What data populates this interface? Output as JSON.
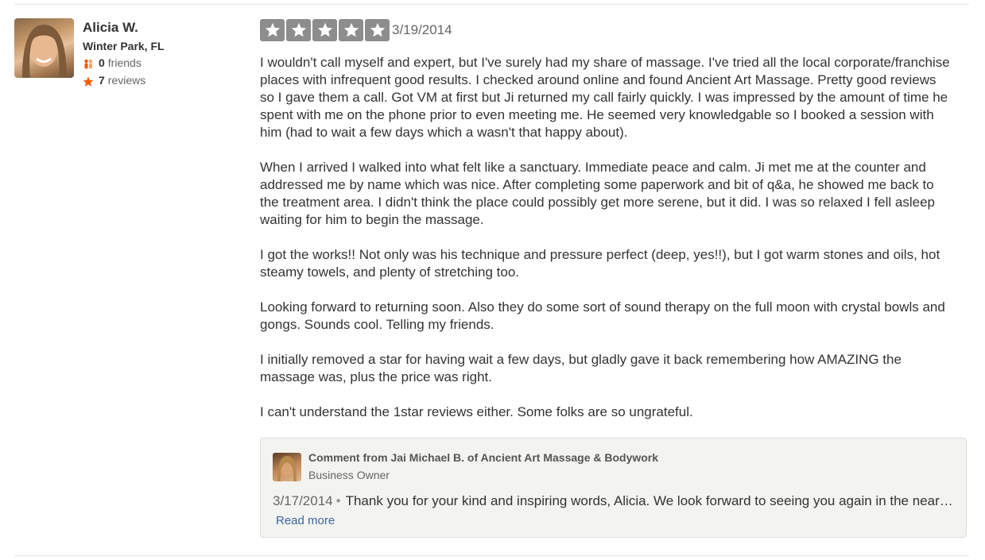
{
  "user": {
    "name": "Alicia W.",
    "location": "Winter Park, FL",
    "friends_count": "0",
    "friends_label": "friends",
    "reviews_count": "7",
    "reviews_label": "reviews"
  },
  "review": {
    "rating": 5,
    "date": "3/19/2014",
    "paragraphs": [
      "I wouldn't call myself and expert, but I've surely had my share of massage. I've tried all the local corporate/franchise places with infrequent good results. I checked around online and found Ancient Art Massage. Pretty good reviews so I gave them a call. Got VM at first but Ji returned my call fairly quickly. I was impressed by the amount of time he spent with me on the phone prior to even meeting me. He seemed very knowledgable so I booked a session with him (had to wait a few days which a wasn't that happy about).",
      "When I arrived I walked into what felt like a sanctuary. Immediate peace and calm. Ji met me at the counter and addressed me by name which was nice. After completing some paperwork and bit of q&a, he showed me back to the treatment area. I didn't think the place could possibly get more serene, but it did. I was so relaxed I fell asleep waiting for him to begin the massage.",
      "I got the works!! Not only was his technique and pressure perfect (deep, yes!!), but I got warm stones and oils, hot steamy towels, and plenty of stretching too.",
      "Looking forward to returning soon. Also they do some sort of sound therapy on the full moon with crystal bowls and gongs. Sounds cool. Telling my friends.",
      "I initially removed a star for having wait a few days, but gladly gave it back remembering how AMAZING the massage was, plus the price was right.",
      "I can't understand the 1star reviews either. Some folks are so ungrateful."
    ]
  },
  "comment": {
    "from": "Comment from Jai Michael B. of Ancient Art Massage & Bodywork",
    "role": "Business Owner",
    "date": "3/17/2014",
    "separator": "•",
    "text": "Thank you for your kind and inspiring words, Alicia. We look forward to seeing you again in the near…",
    "read_more": "Read more"
  },
  "colors": {
    "star_box": "#8d8d8d",
    "friends_icon": "#f15c00",
    "reviews_icon": "#f15c00",
    "link": "#3b65a7"
  },
  "icons": {
    "friends": "friends-icon",
    "reviews": "star-icon"
  }
}
